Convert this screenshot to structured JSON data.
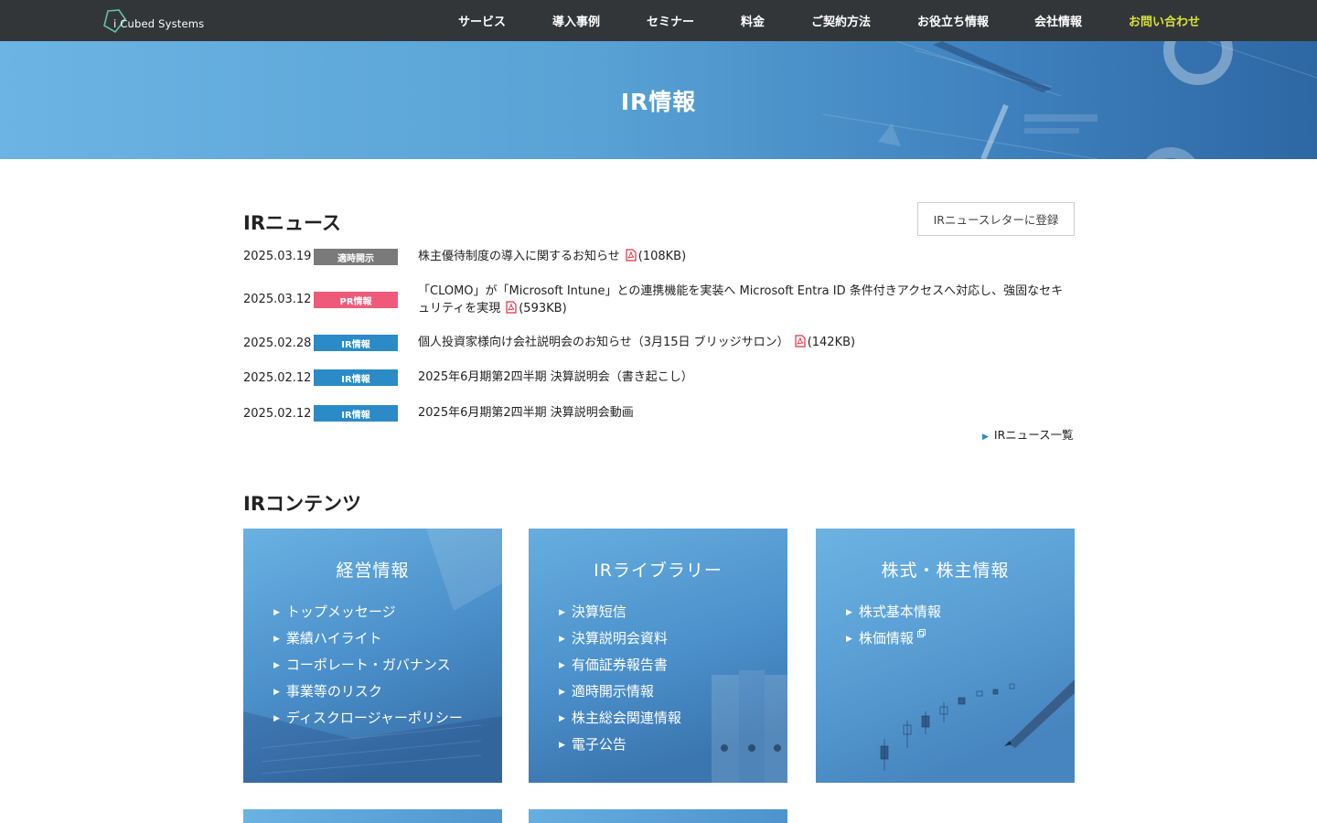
{
  "header": {
    "logo_text": "i Cubed Systems",
    "nav": [
      {
        "label": "サービス"
      },
      {
        "label": "導入事例"
      },
      {
        "label": "セミナー"
      },
      {
        "label": "料金"
      },
      {
        "label": "ご契約方法"
      },
      {
        "label": "お役立ち情報"
      },
      {
        "label": "会社情報"
      },
      {
        "label": "お問い合わせ"
      }
    ]
  },
  "hero": {
    "title": "IR情報"
  },
  "ir_news": {
    "title": "IRニュース",
    "newsletter_button": "IRニュースレターに登録",
    "items": [
      {
        "date": "2025.03.19",
        "badge": "適時開示",
        "badge_color": "#7a7a7a",
        "title": "株主優待制度の導入に関するお知らせ",
        "size": "(108KB)"
      },
      {
        "date": "2025.03.12",
        "badge": "PR情報",
        "badge_color": "#ef5a7a",
        "title": "「CLOMO」が「Microsoft Intune」との連携機能を実装へ Microsoft Entra ID 条件付きアクセスへ対応し、強固なセキュリティを実現",
        "size": "(593KB)"
      },
      {
        "date": "2025.02.28",
        "badge": "IR情報",
        "badge_color": "#2a8bc6",
        "title": "個人投資家様向け会社説明会のお知らせ（3月15日 ブリッジサロン）",
        "size": "(142KB)"
      },
      {
        "date": "2025.02.12",
        "badge": "IR情報",
        "badge_color": "#2a8bc6",
        "title": "2025年6月期第2四半期 決算説明会（書き起こし）"
      },
      {
        "date": "2025.02.12",
        "badge": "IR情報",
        "badge_color": "#2a8bc6",
        "title": "2025年6月期第2四半期 決算説明会動画"
      }
    ],
    "more_link": "IRニュース一覧"
  },
  "ir_contents": {
    "title": "IRコンテンツ",
    "cards": [
      {
        "title": "経営情報",
        "links": [
          "トップメッセージ",
          "業績ハイライト",
          "コーポレート・ガバナンス",
          "事業等のリスク",
          "ディスクロージャーポリシー"
        ]
      },
      {
        "title": "IRライブラリー",
        "links": [
          "決算短信",
          "決算説明会資料",
          "有価証券報告書",
          "適時開示情報",
          "株主総会関連情報",
          "電子公告"
        ]
      },
      {
        "title": "株式・株主情報",
        "links": [
          "株式基本情報",
          "株価情報"
        ]
      }
    ]
  },
  "colors": {
    "header_bg": "#333638",
    "contact_accent": "#d8e23a",
    "card_blue": "#4f98d1",
    "link_triangle": "#2a87c6"
  }
}
